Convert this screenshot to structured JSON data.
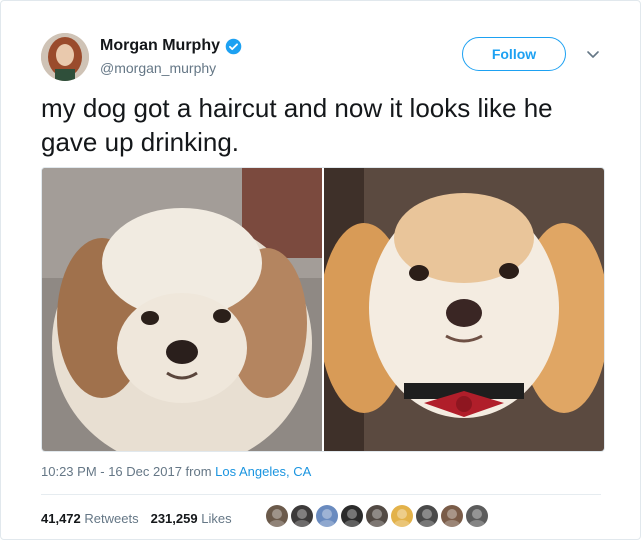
{
  "author": {
    "name": "Morgan Murphy",
    "handle": "@morgan_murphy",
    "verified": true
  },
  "follow_button": {
    "label": "Follow"
  },
  "tweet": {
    "text": "my dog got a haircut and now it looks like he gave up drinking."
  },
  "meta": {
    "time": "10:23 PM - 16 Dec 2017",
    "from_label": " from ",
    "location": "Los Angeles, CA"
  },
  "stats": {
    "retweets_count": "41,472",
    "retweets_label": "Retweets",
    "likes_count": "231,259",
    "likes_label": "Likes"
  },
  "colors": {
    "accent": "#1da1f2",
    "link": "#1b95e0",
    "text": "#14171a",
    "secondary": "#657786"
  },
  "icons": {
    "verified": "verified-badge-icon",
    "caret": "chevron-down-icon"
  },
  "liker_avatars": [
    {
      "color": "#6b5a4b"
    },
    {
      "color": "#3c3a3a"
    },
    {
      "color": "#6a8bbf"
    },
    {
      "color": "#2b2b2b"
    },
    {
      "color": "#524a44"
    },
    {
      "color": "#e3b24a"
    },
    {
      "color": "#4a4a4a"
    },
    {
      "color": "#7a5c48"
    },
    {
      "color": "#5c5c5c"
    }
  ]
}
